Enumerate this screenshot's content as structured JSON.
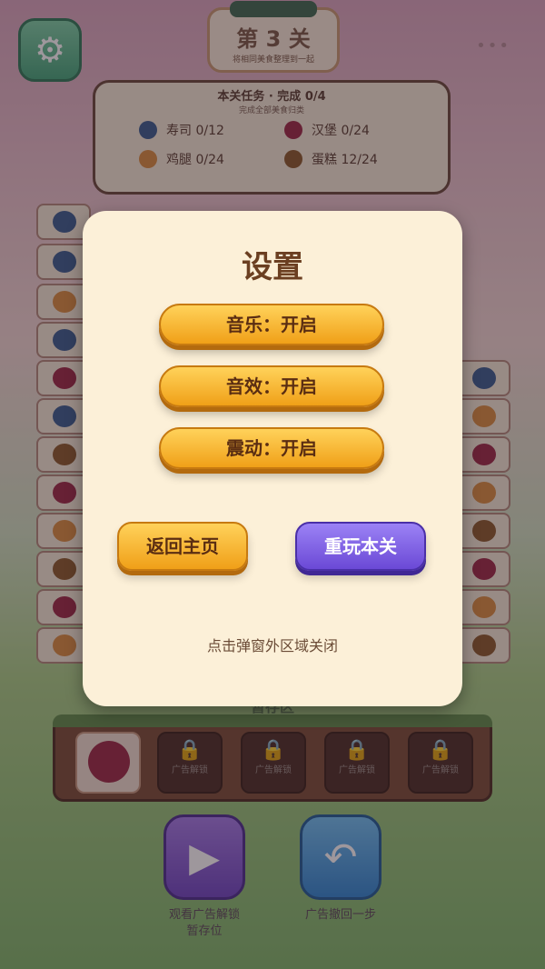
{
  "header": {
    "level_title": "第 3 关",
    "level_subtitle": "将相同美食整理到一起",
    "menu_dots": "•••"
  },
  "task_panel": {
    "title": "本关任务 · 完成 0/4",
    "subtitle": "完成全部美食归类",
    "items": [
      {
        "label": "寿司 0/12",
        "icon": "sushi-icon",
        "color": "#3a5d8e"
      },
      {
        "label": "汉堡 0/24",
        "icon": "cake-icon",
        "color": "#9b2844"
      },
      {
        "label": "鸡腿 0/24",
        "icon": "chicken-leg-icon",
        "color": "#d98c3f"
      },
      {
        "label": "蛋糕 12/24",
        "icon": "burger-icon",
        "color": "#8a5a2b"
      }
    ]
  },
  "hold_area": {
    "label": "暂存区",
    "slots": [
      "",
      "广告解锁",
      "广告解锁",
      "广告解锁",
      "广告解锁"
    ]
  },
  "bottom_bar": {
    "video_label_line1": "观看广告解锁",
    "video_label_line2": "暂存位",
    "undo_label": "广告撤回一步"
  },
  "modal": {
    "title": "设置",
    "music_label": "音乐：开启",
    "sfx_label": "音效：开启",
    "vibration_label": "震动：开启",
    "home_label": "返回主页",
    "replay_label": "重玩本关",
    "close_hint": "点击弹窗外区域关闭"
  },
  "colors": {
    "toggle_gold": "#f0a018",
    "replay_purple": "#6b49d6",
    "modal_bg": "#fcf0d8"
  }
}
